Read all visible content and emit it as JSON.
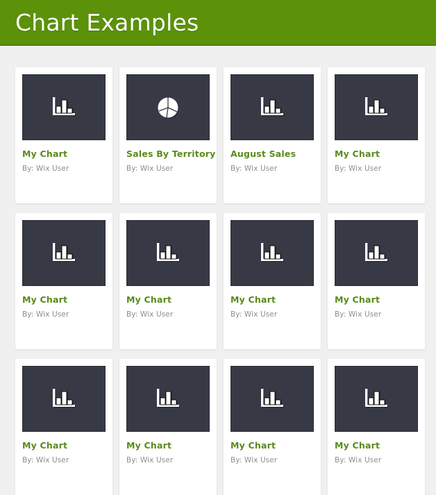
{
  "header": {
    "title": "Chart Examples",
    "background_color": "#5b9209",
    "text_color": "#ffffff"
  },
  "theme": {
    "page_background": "#f0f0f0",
    "card_background": "#ffffff",
    "thumbnail_background": "#373a45",
    "title_color": "#5a8a1b",
    "author_color": "#8d8d8d"
  },
  "gallery": {
    "rows": [
      {
        "cards": [
          {
            "icon": "bar-chart-icon",
            "title": "My Chart",
            "author": "By: Wix User"
          },
          {
            "icon": "pie-chart-icon",
            "title": "Sales By Territory",
            "author": "By: Wix User"
          },
          {
            "icon": "bar-chart-icon",
            "title": "August Sales",
            "author": "By: Wix User"
          },
          {
            "icon": "bar-chart-icon",
            "title": "My Chart",
            "author": "By: Wix User"
          }
        ]
      },
      {
        "cards": [
          {
            "icon": "bar-chart-icon",
            "title": "My Chart",
            "author": "By: Wix User"
          },
          {
            "icon": "bar-chart-icon",
            "title": "My Chart",
            "author": "By: Wix User"
          },
          {
            "icon": "bar-chart-icon",
            "title": "My Chart",
            "author": "By: Wix User"
          },
          {
            "icon": "bar-chart-icon",
            "title": "My Chart",
            "author": "By: Wix User"
          }
        ]
      },
      {
        "cards": [
          {
            "icon": "bar-chart-icon",
            "title": "My Chart",
            "author": "By: Wix User"
          },
          {
            "icon": "bar-chart-icon",
            "title": "My Chart",
            "author": "By: Wix User"
          },
          {
            "icon": "bar-chart-icon",
            "title": "My Chart",
            "author": "By: Wix User"
          },
          {
            "icon": "bar-chart-icon",
            "title": "My Chart",
            "author": "By: Wix User"
          }
        ]
      }
    ]
  }
}
